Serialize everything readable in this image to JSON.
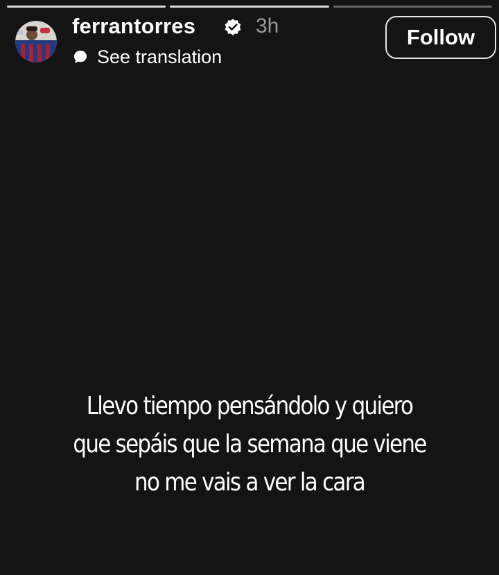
{
  "story": {
    "progress_segments": [
      {
        "state": "done"
      },
      {
        "state": "done"
      },
      {
        "state": "pending"
      }
    ],
    "header": {
      "avatar_icon": "profile-photo-avatar",
      "username": "ferrantorres",
      "verified_icon": "verified-badge-icon",
      "timestamp": "3h",
      "translation_icon": "speech-bubble-icon",
      "translation_label": "See translation",
      "follow_label": "Follow"
    },
    "text_lines": [
      "Llevo tiempo pensándolo y quiero",
      "que sepáis que la semana que viene",
      "no me vais a ver la cara"
    ],
    "colors": {
      "background": "#141414",
      "text": "#ffffff",
      "timestamp": "#9a9a9a",
      "button_border": "#e6e6e6"
    }
  }
}
